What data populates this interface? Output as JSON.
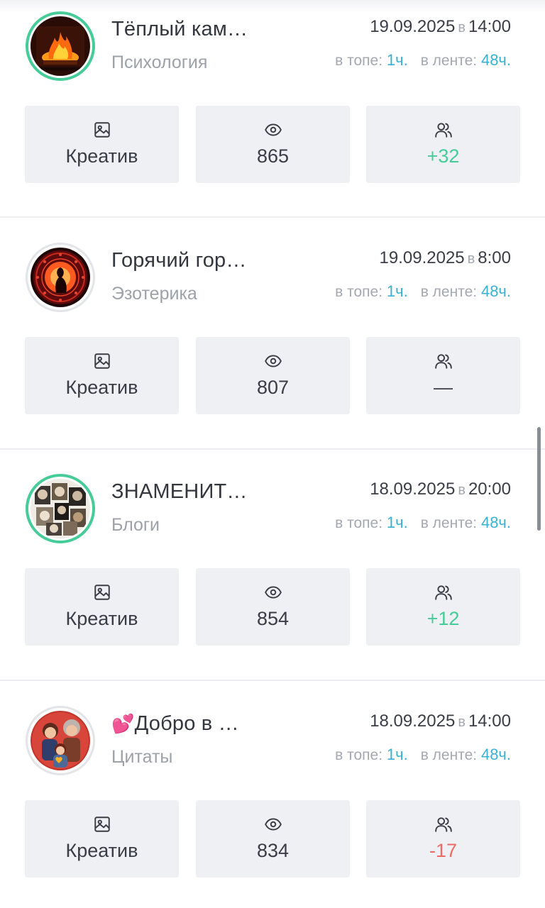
{
  "labels": {
    "date_sep": "в",
    "top_label": "в топе:",
    "feed_label": "в ленте:"
  },
  "colors": {
    "accent_green": "#45cc98",
    "accent_blue": "#38b2d4",
    "negative_red": "#ee6a66",
    "tile_bg": "#eef0f4"
  },
  "icons": [
    "image-icon",
    "eye-icon",
    "users-icon"
  ],
  "posts": [
    {
      "title": "Тёплый кам…",
      "category": "Психология",
      "date": "19.09.2025",
      "time": "14:00",
      "top": "1ч.",
      "feed": "48ч.",
      "creative": "Креатив",
      "views": "865",
      "subs": "+32",
      "subs_state": "pos",
      "avatar_active": true
    },
    {
      "title": "Горячий гор…",
      "category": "Эзотерика",
      "date": "19.09.2025",
      "time": "8:00",
      "top": "1ч.",
      "feed": "48ч.",
      "creative": "Креатив",
      "views": "807",
      "subs": "—",
      "subs_state": "neutral",
      "avatar_active": false
    },
    {
      "title": "ЗНАМЕНИТ…",
      "category": "Блоги",
      "date": "18.09.2025",
      "time": "20:00",
      "top": "1ч.",
      "feed": "48ч.",
      "creative": "Креатив",
      "views": "854",
      "subs": "+12",
      "subs_state": "pos",
      "avatar_active": true
    },
    {
      "title_emoji": "💕",
      "title": "Добро в …",
      "category": "Цитаты",
      "date": "18.09.2025",
      "time": "14:00",
      "top": "1ч.",
      "feed": "48ч.",
      "creative": "Креатив",
      "views": "834",
      "subs": "-17",
      "subs_state": "neg",
      "avatar_active": false
    }
  ]
}
